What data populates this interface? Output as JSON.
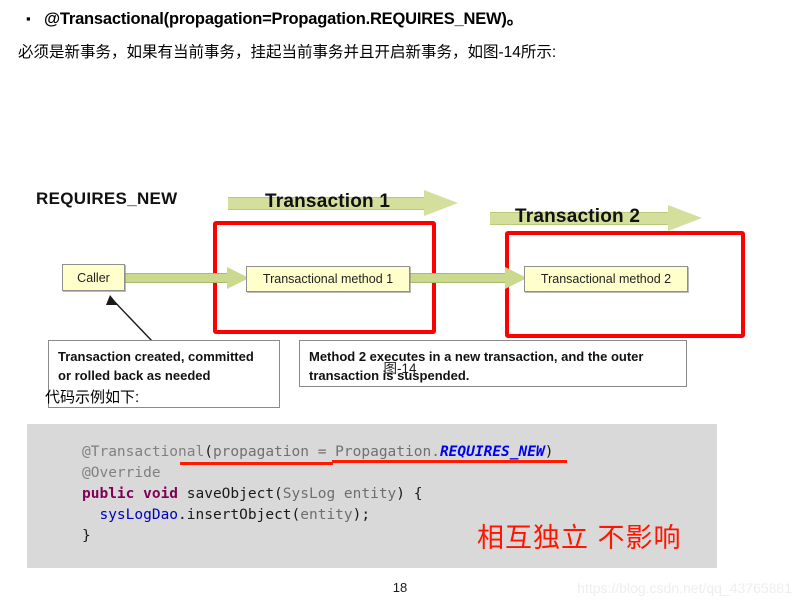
{
  "slide": {
    "bullet_mark": "▪",
    "bullet_title": "@Transactional(propagation=Propagation.REQUIRES_NEW)。",
    "intro_sentence": "必须是新事务，如果有当前事务，挂起当前事务并且开启新事务，如图-14所示:",
    "page_number": "18",
    "watermark": "https://blog.csdn.net/qq_43765881"
  },
  "figure": {
    "title_label": "REQUIRES_NEW",
    "caption": "图-14",
    "banners": [
      {
        "text": "Transaction 1"
      },
      {
        "text": "Transaction 2"
      }
    ],
    "boxes": [
      {
        "text": "Caller"
      },
      {
        "text": "Transactional method 1"
      },
      {
        "text": "Transactional method 2"
      }
    ],
    "notes": [
      {
        "text": "Transaction created, committed or rolled back as needed"
      },
      {
        "text": "Method 2 executes in a new transaction, and the outer transaction is suspended."
      }
    ],
    "colors": {
      "highlight_box": "#ff0000",
      "arrow_fill": "#d4df9b",
      "node_fill": "#ffffcc"
    }
  },
  "code": {
    "intro": "代码示例如下:",
    "annotation": "相互独立 不影响",
    "lines": [
      {
        "tokens": [
          {
            "t": "@Transactional",
            "c": "tok-ann"
          },
          {
            "t": "(",
            "c": "tok-plain"
          },
          {
            "t": "propagation = Propagation.",
            "c": "tok-dim"
          },
          {
            "t": "REQUIRES_NEW",
            "c": "tok-const"
          },
          {
            "t": ")",
            "c": "tok-plain"
          }
        ]
      },
      {
        "tokens": [
          {
            "t": "@Override",
            "c": "tok-ann"
          }
        ]
      },
      {
        "tokens": [
          {
            "t": "public void",
            "c": "tok-kw"
          },
          {
            "t": " saveObject(",
            "c": "tok-plain"
          },
          {
            "t": "SysLog entity",
            "c": "tok-type"
          },
          {
            "t": ") {",
            "c": "tok-plain"
          }
        ]
      },
      {
        "tokens": [
          {
            "t": "  ",
            "c": "tok-plain"
          },
          {
            "t": "sysLogDao",
            "c": "tok-field"
          },
          {
            "t": ".insertObject(",
            "c": "tok-plain"
          },
          {
            "t": "entity",
            "c": "tok-type"
          },
          {
            "t": ");",
            "c": "tok-plain"
          }
        ]
      },
      {
        "tokens": [
          {
            "t": "}",
            "c": "tok-plain"
          }
        ]
      }
    ],
    "colors": {
      "background": "#d9d9d9",
      "underline": "#ff1a00",
      "annotation": "#ff1500"
    }
  }
}
